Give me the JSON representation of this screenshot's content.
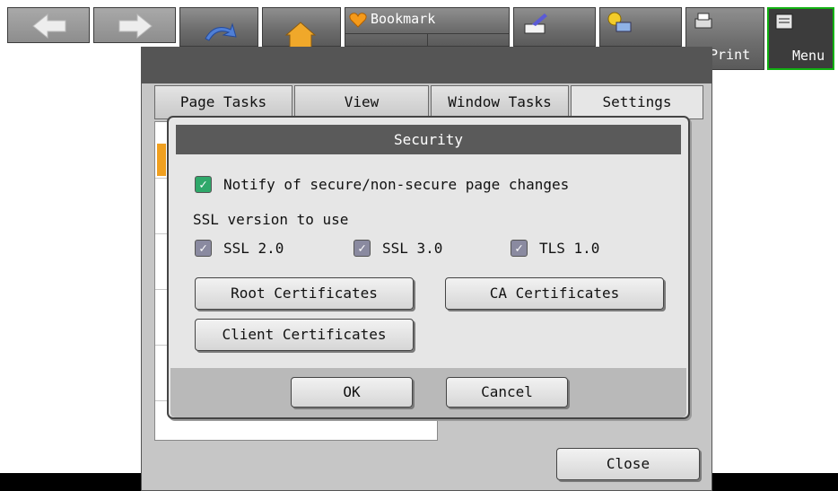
{
  "toolbar": {
    "bookmark_label": "Bookmark",
    "print_label": "Print",
    "menu_label": "Menu"
  },
  "tabs": [
    "Page Tasks",
    "View",
    "Window Tasks",
    "Settings"
  ],
  "dialog": {
    "title": "Security",
    "notify_label": "Notify of secure/non-secure page changes",
    "notify_checked": true,
    "ssl_heading": "SSL version to use",
    "ssl_options": [
      {
        "label": "SSL 2.0",
        "checked": true
      },
      {
        "label": "SSL 3.0",
        "checked": true
      },
      {
        "label": "TLS 1.0",
        "checked": true
      }
    ],
    "root_certs_label": "Root Certificates",
    "ca_certs_label": "CA Certificates",
    "client_certs_label": "Client Certificates",
    "ok_label": "OK",
    "cancel_label": "Cancel"
  },
  "close_label": "Close",
  "colors": {
    "accent_green": "#2fa86a",
    "menu_border": "#11b011",
    "title_bar": "#5a5a5a"
  },
  "icons": [
    "back-arrow-icon",
    "forward-arrow-icon",
    "refresh-icon",
    "home-icon",
    "heart-icon",
    "url-icon",
    "settings-key-icon",
    "printer-icon",
    "menu-icon"
  ]
}
